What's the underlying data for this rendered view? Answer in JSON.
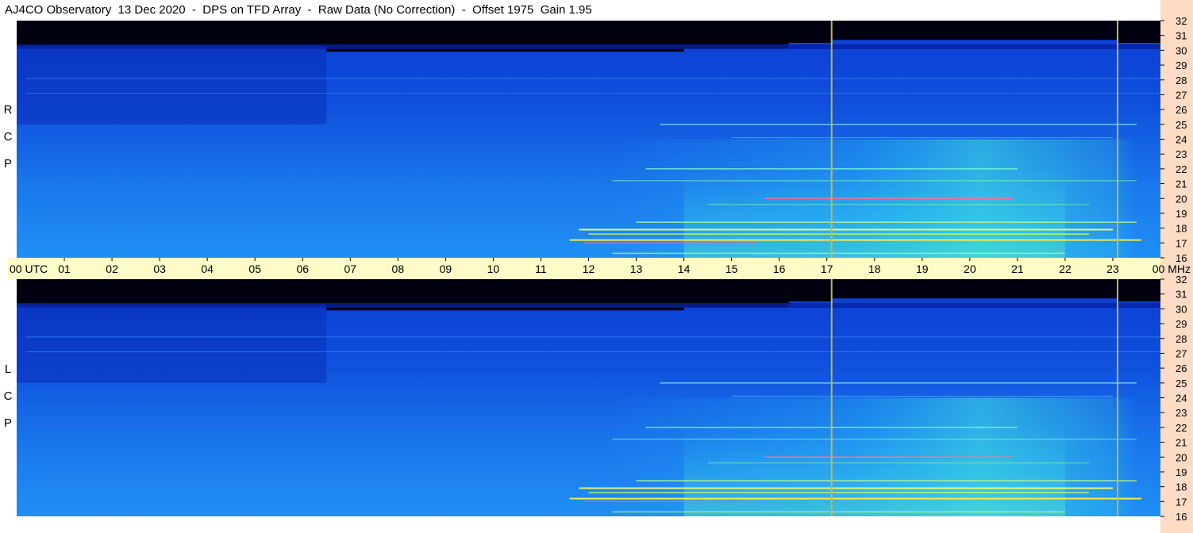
{
  "title": "AJ4CO Observatory  13 Dec 2020  -  DPS on TFD Array  -  Raw Data (No Correction)  -  Offset 1975  Gain 1.95",
  "colors": {
    "freq_column": "#fddcc6",
    "utc_band": "#fdfbc6",
    "marker_line": "#c8b45a",
    "spectrogram_dark": "#000010",
    "spectrogram_blue": "#0a3cd2"
  },
  "chart_data": [
    {
      "type": "heatmap",
      "panel": "RCP",
      "polarization_label": [
        "R",
        "C",
        "P"
      ],
      "x_label": "UTC",
      "y_label": "MHz",
      "x_ticks": [
        "00 UTC",
        "01",
        "02",
        "03",
        "04",
        "05",
        "06",
        "07",
        "08",
        "09",
        "10",
        "11",
        "12",
        "13",
        "14",
        "15",
        "16",
        "17",
        "18",
        "19",
        "20",
        "21",
        "22",
        "23",
        "00 MHz"
      ],
      "y_ticks": [
        "32",
        "31",
        "30",
        "29",
        "28",
        "27",
        "26",
        "25",
        "24",
        "23",
        "22",
        "21",
        "20",
        "19",
        "18",
        "17",
        "16"
      ],
      "xlim_hours": [
        0,
        24
      ],
      "ylim_mhz": [
        16,
        32
      ],
      "marker_lines_utc": [
        17.1,
        23.1
      ],
      "bright_activity_utc": [
        11.7,
        23.5
      ]
    },
    {
      "type": "heatmap",
      "panel": "LCP",
      "polarization_label": [
        "L",
        "C",
        "P"
      ],
      "x_label": "UTC",
      "y_label": "MHz",
      "y_ticks": [
        "32",
        "31",
        "30",
        "29",
        "28",
        "27",
        "26",
        "25",
        "24",
        "23",
        "22",
        "21",
        "20",
        "19",
        "18",
        "17",
        "16"
      ],
      "xlim_hours": [
        0,
        24
      ],
      "ylim_mhz": [
        16,
        32
      ],
      "marker_lines_utc": [
        17.1,
        23.1
      ],
      "bright_activity_utc": [
        11.7,
        23.5
      ]
    }
  ]
}
